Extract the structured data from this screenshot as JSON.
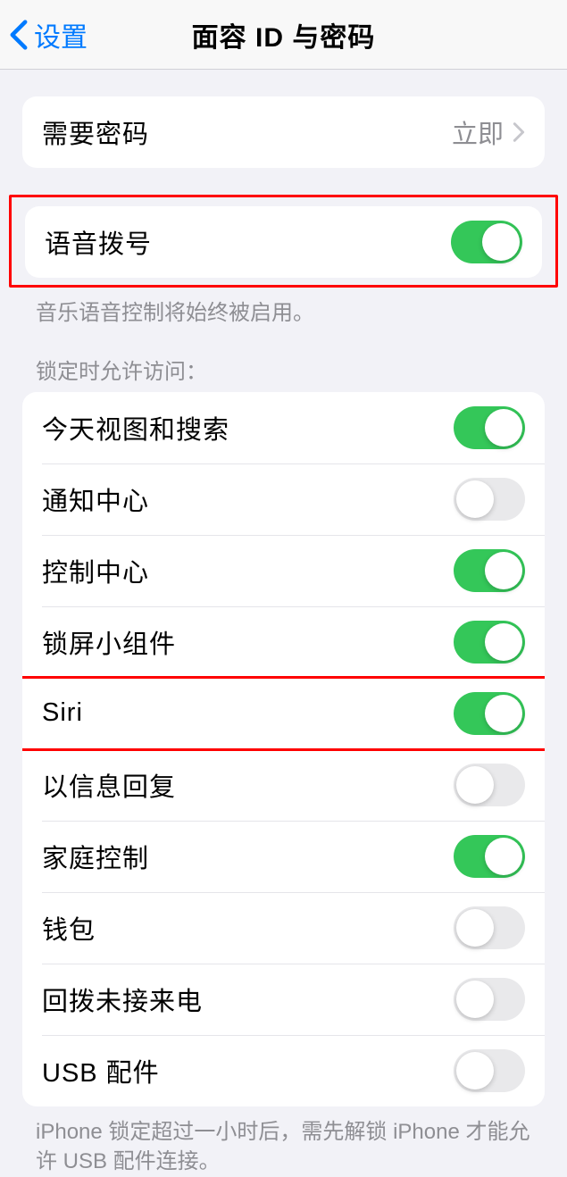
{
  "nav": {
    "back_label": "设置",
    "title": "面容 ID 与密码"
  },
  "passcode": {
    "label": "需要密码",
    "value": "立即"
  },
  "voice_dial": {
    "label": "语音拨号",
    "on": true,
    "footer": "音乐语音控制将始终被启用。"
  },
  "lock_access": {
    "header": "锁定时允许访问：",
    "items": [
      {
        "label": "今天视图和搜索",
        "on": true
      },
      {
        "label": "通知中心",
        "on": false
      },
      {
        "label": "控制中心",
        "on": true
      },
      {
        "label": "锁屏小组件",
        "on": true
      },
      {
        "label": "Siri",
        "on": true
      },
      {
        "label": "以信息回复",
        "on": false
      },
      {
        "label": "家庭控制",
        "on": true
      },
      {
        "label": "钱包",
        "on": false
      },
      {
        "label": "回拨未接来电",
        "on": false
      },
      {
        "label": "USB 配件",
        "on": false
      }
    ],
    "footer": "iPhone 锁定超过一小时后，需先解锁 iPhone 才能允许 USB 配件连接。"
  }
}
